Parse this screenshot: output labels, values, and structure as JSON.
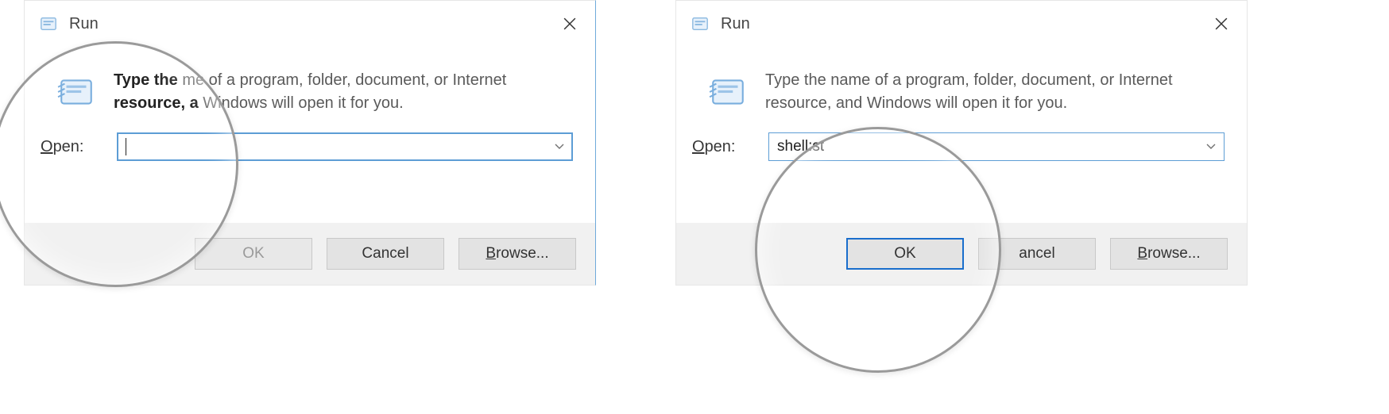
{
  "left": {
    "title": "Run",
    "desc_line1_bold": "Type the",
    "desc_line1_rest": "me of a program, folder, document, or Internet",
    "desc_line2_bold": "resource, a",
    "desc_line2_rest": "Windows will open it for you.",
    "open_label_u": "O",
    "open_label_rest": "pen:",
    "input_value": "",
    "ok": "OK",
    "cancel": "Cancel",
    "browse_u": "B",
    "browse_rest": "rowse..."
  },
  "right": {
    "title": "Run",
    "desc_full": "Type the name of a program, folder, document, or Internet resource, and Windows will open it for you.",
    "open_label_u": "O",
    "open_label_rest": "pen:",
    "input_value": "shell:st",
    "ok": "OK",
    "cancel_rest": "ancel",
    "browse_u": "B",
    "browse_rest": "rowse..."
  }
}
